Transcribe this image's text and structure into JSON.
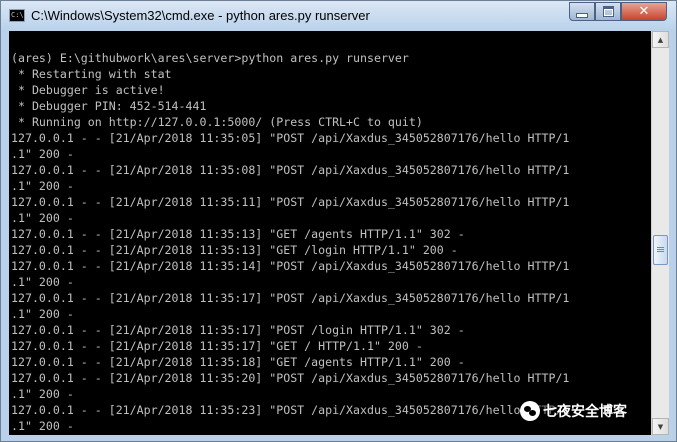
{
  "window": {
    "title": "C:\\Windows\\System32\\cmd.exe - python  ares.py runserver",
    "app_icon_text": "C:\\",
    "close_glyph": "✕"
  },
  "console": {
    "text_color": "#c0c0c0",
    "background": "#000000",
    "lines": [
      "(ares) E:\\githubwork\\ares\\server>python ares.py runserver",
      " * Restarting with stat",
      " * Debugger is active!",
      " * Debugger PIN: 452-514-441",
      " * Running on http://127.0.0.1:5000/ (Press CTRL+C to quit)",
      "127.0.0.1 - - [21/Apr/2018 11:35:05] \"POST /api/Xaxdus_345052807176/hello HTTP/1",
      ".1\" 200 -",
      "127.0.0.1 - - [21/Apr/2018 11:35:08] \"POST /api/Xaxdus_345052807176/hello HTTP/1",
      ".1\" 200 -",
      "127.0.0.1 - - [21/Apr/2018 11:35:11] \"POST /api/Xaxdus_345052807176/hello HTTP/1",
      ".1\" 200 -",
      "127.0.0.1 - - [21/Apr/2018 11:35:13] \"GET /agents HTTP/1.1\" 302 -",
      "127.0.0.1 - - [21/Apr/2018 11:35:13] \"GET /login HTTP/1.1\" 200 -",
      "127.0.0.1 - - [21/Apr/2018 11:35:14] \"POST /api/Xaxdus_345052807176/hello HTTP/1",
      ".1\" 200 -",
      "127.0.0.1 - - [21/Apr/2018 11:35:17] \"POST /api/Xaxdus_345052807176/hello HTTP/1",
      ".1\" 200 -",
      "127.0.0.1 - - [21/Apr/2018 11:35:17] \"POST /login HTTP/1.1\" 302 -",
      "127.0.0.1 - - [21/Apr/2018 11:35:17] \"GET / HTTP/1.1\" 200 -",
      "127.0.0.1 - - [21/Apr/2018 11:35:18] \"GET /agents HTTP/1.1\" 200 -",
      "127.0.0.1 - - [21/Apr/2018 11:35:20] \"POST /api/Xaxdus_345052807176/hello HTTP/1",
      ".1\" 200 -",
      "127.0.0.1 - - [21/Apr/2018 11:35:23] \"POST /api/Xaxdus_345052807176/hello HTTP/1",
      ".1\" 200 -"
    ]
  },
  "scrollbar": {
    "up_arrow": "▲",
    "down_arrow": "▼",
    "position_fraction": 0.55
  },
  "watermark": {
    "text": "七夜安全博客"
  }
}
